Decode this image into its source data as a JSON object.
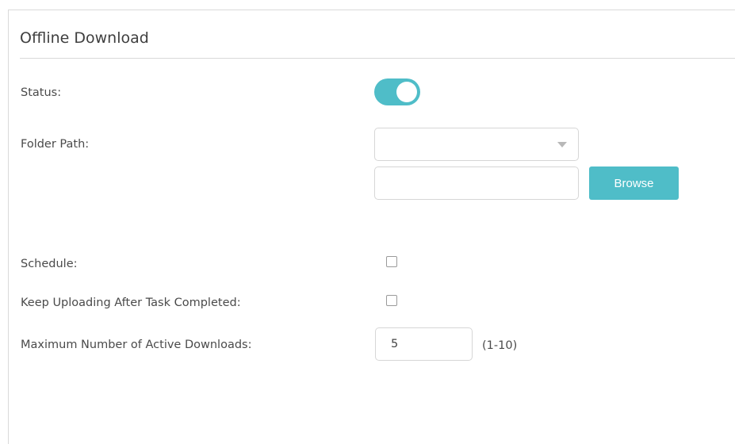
{
  "section": {
    "title": "Offline Download"
  },
  "form": {
    "status": {
      "label": "Status:",
      "enabled": true
    },
    "folder_path": {
      "label": "Folder Path:",
      "select_value": "",
      "path_value": "",
      "browse_label": "Browse"
    },
    "schedule": {
      "label": "Schedule:",
      "checked": false
    },
    "keep_uploading": {
      "label": "Keep Uploading After Task Completed:",
      "checked": false
    },
    "max_downloads": {
      "label": "Maximum Number of Active Downloads:",
      "value": "5",
      "range_hint": "(1-10)"
    }
  },
  "colors": {
    "accent": "#4fbdc8",
    "border": "#d6d6d6",
    "text": "#4a4a4a"
  },
  "icons": {
    "dropdown": "caret-down-icon"
  }
}
